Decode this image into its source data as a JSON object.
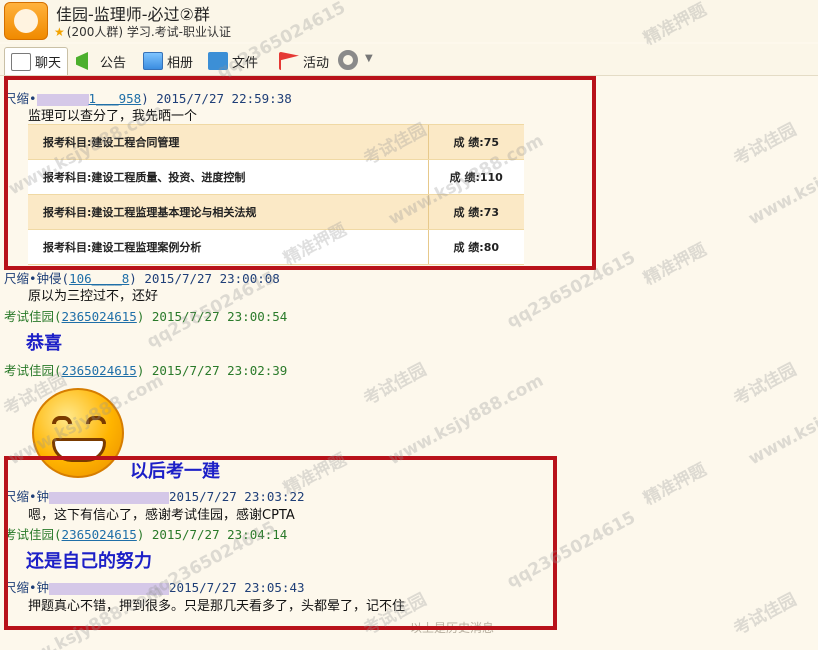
{
  "header": {
    "title": "佳园-监理师-必过②群",
    "info": "(200人群) 学习.考试-职业认证"
  },
  "toolbar": [
    {
      "label": "聊天",
      "icon": "chat-icon"
    },
    {
      "label": "公告",
      "icon": "notice-flag-icon"
    },
    {
      "label": "相册",
      "icon": "album-icon"
    },
    {
      "label": "文件",
      "icon": "folder-icon"
    },
    {
      "label": "活动",
      "icon": "event-flag-icon"
    }
  ],
  "messages": [
    {
      "sender": "尺缩•",
      "qq": "1___958",
      "time": "2015/7/27 22:59:38",
      "text": "监理可以查分了，我先晒一个"
    },
    {
      "sender": "尺缩•钟侵",
      "qq": "106____8",
      "time": "2015/7/27 23:00:08",
      "text": "原以为三控过不，还好"
    },
    {
      "sender": "考试佳园",
      "qq": "2365024615",
      "time": "2015/7/27 23:00:54",
      "big_text": "恭喜"
    },
    {
      "sender": "考试佳园",
      "qq": "2365024615",
      "time": "2015/7/27 23:02:39",
      "big_text": "以后考一建"
    },
    {
      "sender": "尺缩•钟",
      "time": "2015/7/27 23:03:22",
      "text": "嗯，这下有信心了，感谢考试佳园，感谢CPTA"
    },
    {
      "sender": "考试佳园",
      "qq": "2365024615",
      "time": "2015/7/27 23:04:14",
      "big_text": "还是自己的努力"
    },
    {
      "sender": "尺缩•钟",
      "time": "2015/7/27 23:05:43",
      "text": "押题真心不错，押到很多。只是那几天看多了，头都晕了，记不住"
    }
  ],
  "score_table": [
    {
      "subject": "报考科目:建设工程合同管理",
      "score": "成 绩:75"
    },
    {
      "subject": "报考科目:建设工程质量、投资、进度控制",
      "score": "成 绩:110"
    },
    {
      "subject": "报考科目:建设工程监理基本理论与相关法规",
      "score": "成 绩:73"
    },
    {
      "subject": "报考科目:建设工程监理案例分析",
      "score": "成 绩:80"
    }
  ],
  "watermarks": {
    "brand": "考试佳园",
    "site": "www.ksjy888.com",
    "qq": "qq2365024615",
    "slogan": "精准押题"
  },
  "footer": "以上是历史消息"
}
